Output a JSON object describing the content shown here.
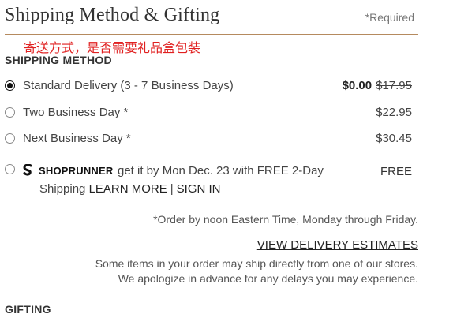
{
  "header": {
    "title": "Shipping Method & Gifting",
    "required": "*Required"
  },
  "annotation": "寄送方式，是否需要礼品盒包装",
  "shipping_method": {
    "heading": "SHIPPING METHOD",
    "options": [
      {
        "label": "Standard Delivery (3 - 7 Business Days)",
        "price": "$0.00",
        "original_price": "$17.95",
        "selected": true
      },
      {
        "label": "Two Business Day *",
        "price": "$22.95",
        "selected": false
      },
      {
        "label": "Next Business Day *",
        "price": "$30.45",
        "selected": false
      }
    ],
    "shoprunner": {
      "brand": "SHOPRUNNER",
      "line1": "get it by Mon Dec. 23 with FREE 2-Day",
      "line2_prefix": "Shipping",
      "learn_more": "LEARN MORE",
      "separator": "|",
      "sign_in": "SIGN IN",
      "price": "FREE",
      "selected": false
    },
    "order_note": "*Order by noon Eastern Time, Monday through Friday.",
    "delivery_estimates_link": "VIEW DELIVERY ESTIMATES",
    "store_note_line1": "Some items in your order may ship directly from one of our stores.",
    "store_note_line2": "We apologize in advance for any delays you may experience."
  },
  "gifting": {
    "heading": "GIFTING"
  },
  "colors": {
    "divider": "#b58a5e",
    "annotation": "#e02020",
    "text": "#444444"
  }
}
